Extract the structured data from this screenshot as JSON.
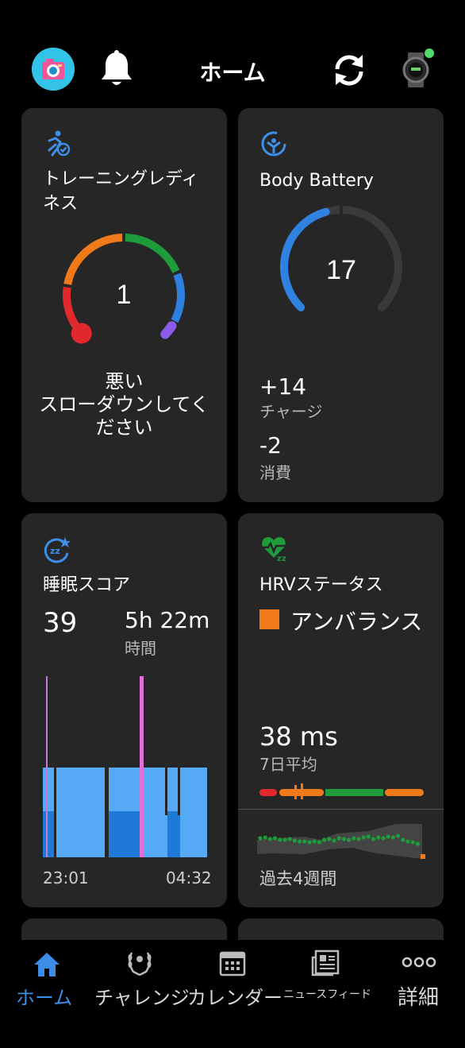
{
  "header": {
    "title": "ホーム",
    "watch_connected": true
  },
  "training_readiness": {
    "label": "トレーニングレディネス",
    "label_line1": "トレーニングレディ",
    "label_line2": "ネス",
    "score": "1",
    "status": "悪い",
    "advice_line1": "スローダウンしてく",
    "advice_line2": "ださい",
    "level": 0.01,
    "colors": {
      "poor": "#e1282c",
      "low": "#f07a1a",
      "moderate": "#1e9b3a",
      "high": "#2f7fdf",
      "prime": "#8a5be8"
    }
  },
  "body_battery": {
    "label": "Body Battery",
    "value": "17",
    "level": 0.17,
    "charge_value": "+14",
    "charge_label": "チャージ",
    "drain_value": "-2",
    "drain_label": "消費",
    "colors": {
      "fill": "#2f82e0",
      "track": "#3a3a3a"
    }
  },
  "sleep_score": {
    "label": "睡眠スコア",
    "score": "39",
    "duration": "5h 22m",
    "duration_label": "時間",
    "start_time": "23:01",
    "end_time": "04:32",
    "colors": {
      "light": "#56a9f5",
      "deep": "#1e7ad6",
      "rem": "#e06fd6",
      "awake": "#c77ad9"
    }
  },
  "hrv_status": {
    "label": "HRVステータス",
    "status": "アンバランス",
    "status_color": "#f07a1a",
    "avg_value": "38 ms",
    "avg_label": "7日平均",
    "trend_label": "過去4週間",
    "colors": {
      "low": "#e1282c",
      "unbalanced": "#f07a1a",
      "balanced": "#1e9b3a",
      "dots": "#1e9b3a"
    }
  },
  "bottom_nav": {
    "items": [
      {
        "key": "home",
        "label": "ホーム",
        "active": true
      },
      {
        "key": "challenge",
        "label": "チャレンジ",
        "active": false
      },
      {
        "key": "calendar",
        "label": "カレンダー",
        "active": false
      },
      {
        "key": "news",
        "label": "ニュースフィード",
        "active": false
      },
      {
        "key": "more",
        "label": "詳細",
        "active": false
      }
    ],
    "active_color": "#3b8de6"
  }
}
